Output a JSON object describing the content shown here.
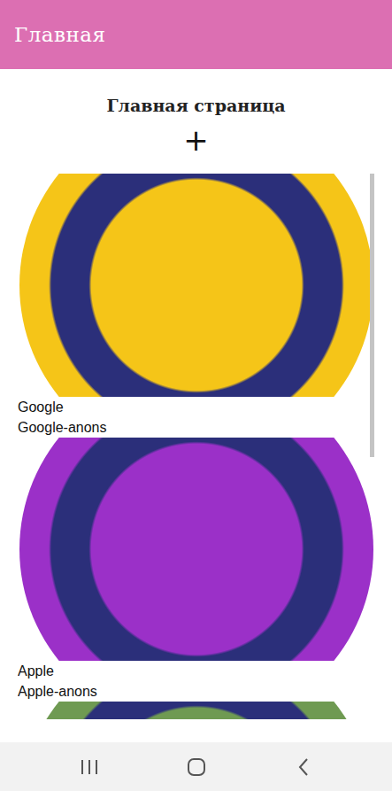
{
  "app_bar": {
    "title": "Главная"
  },
  "page": {
    "heading": "Главная страница",
    "add_button": "+"
  },
  "items": [
    {
      "title": "Google",
      "subtitle": "Google-anons",
      "color": "#f5c518"
    },
    {
      "title": "Apple",
      "subtitle": "Apple-anons",
      "color": "#9b30c8"
    },
    {
      "color": "#6f9a52"
    }
  ],
  "scrollbar": {
    "level": 0.52
  }
}
